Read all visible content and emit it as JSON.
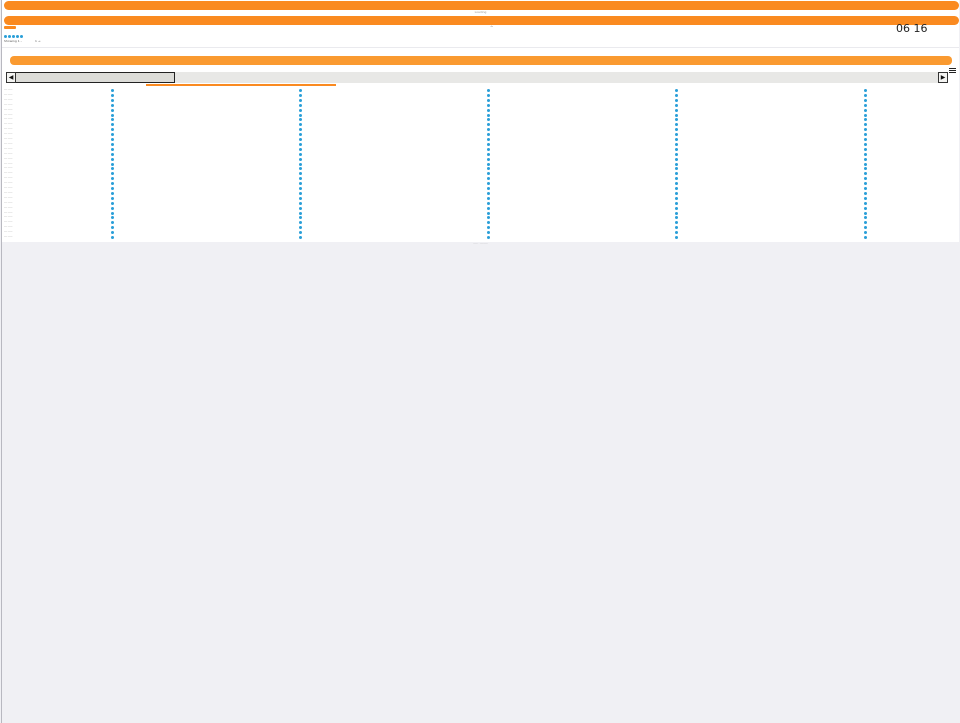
{
  "header": {
    "title": "Loading",
    "caret": "^",
    "time": "06 16",
    "caption_parts": [
      "Showing 1 –",
      "",
      "1 →"
    ]
  },
  "rating_dots": 5,
  "scrollbar": {
    "left_arrow": "◀",
    "right_arrow": "▶"
  },
  "grid": {
    "row_label": "── ───",
    "row_count": 31,
    "column_count": 5
  },
  "footer": "───  ·  ─────",
  "colors": {
    "accent": "#fa8a20",
    "dot": "#2a9fd8"
  }
}
